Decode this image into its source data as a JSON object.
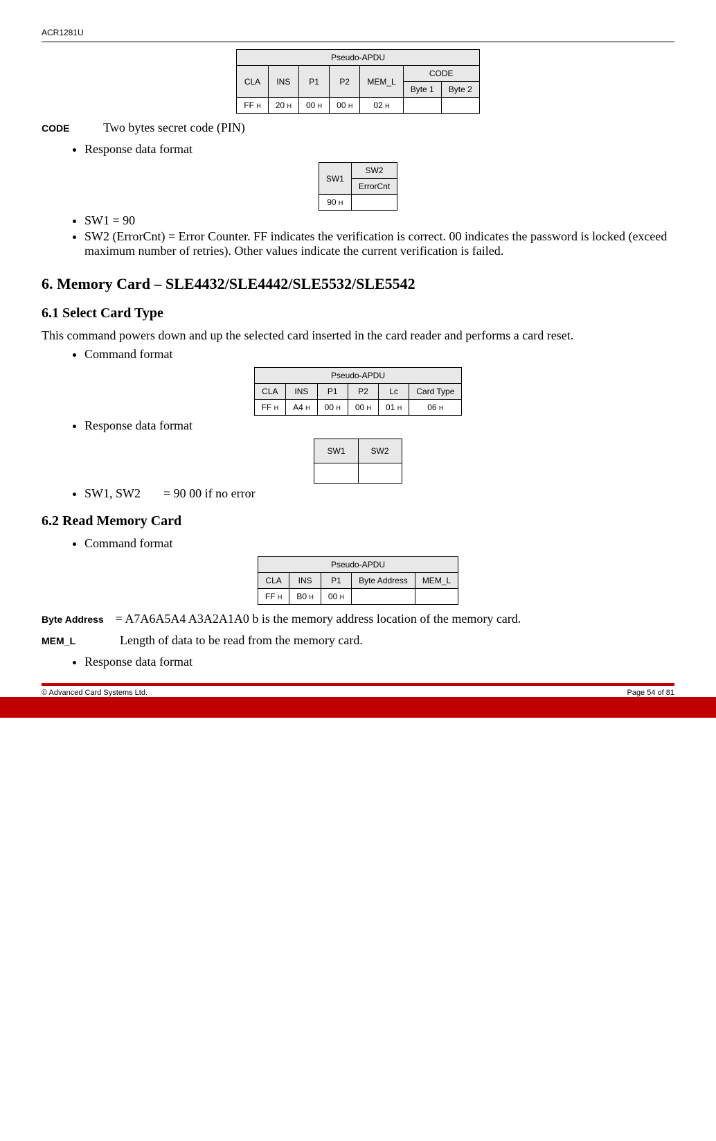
{
  "header": "ACR1281U",
  "table1": {
    "title": "Pseudo-APDU",
    "headers": [
      "CLA",
      "INS",
      "P1",
      "P2",
      "MEM_L",
      "CODE"
    ],
    "subheaders": [
      "Byte 1",
      "Byte 2"
    ],
    "row": [
      "FF",
      "20",
      "00",
      "00",
      "02",
      "",
      ""
    ]
  },
  "code_def": {
    "label": "CODE",
    "text": "Two bytes secret code (PIN)"
  },
  "bullets1": [
    "Response data format"
  ],
  "table2": {
    "h1": "SW1",
    "h2": "SW2",
    "h2sub": "ErrorCnt",
    "row": [
      "90",
      ""
    ]
  },
  "bullets2": [
    "SW1 = 90",
    "SW2 (ErrorCnt) = Error Counter.  FF indicates the verification is correct.  00 indicates the password is locked (exceed maximum number of retries).  Other values indicate the current verification is failed."
  ],
  "section6": "6. Memory Card – SLE4432/SLE4442/SLE5532/SLE5542",
  "section61": "6.1 Select Card Type",
  "para61": "This command powers down and up the selected card inserted in the card reader and performs a card reset.",
  "bullets3": [
    "Command format"
  ],
  "table3": {
    "title": "Pseudo-APDU",
    "headers": [
      "CLA",
      "INS",
      "P1",
      "P2",
      "Lc",
      "Card Type"
    ],
    "row": [
      "FF",
      "A4",
      "00",
      "00",
      "01",
      "06"
    ]
  },
  "bullets4": [
    "Response data format"
  ],
  "table4": {
    "h1": "SW1",
    "h2": "SW2"
  },
  "bullets5_prefix": "SW1, SW2",
  "bullets5_text": "= 90  00  if no error",
  "section62": "6.2 Read Memory Card",
  "bullets6": [
    "Command format"
  ],
  "table5": {
    "title": "Pseudo-APDU",
    "headers": [
      "CLA",
      "INS",
      "P1",
      "Byte Address",
      "MEM_L"
    ],
    "row": [
      "FF",
      "B0",
      "00",
      "",
      ""
    ]
  },
  "byte_addr": {
    "label": "Byte Address",
    "text": "= A7A6A5A4 A3A2A1A0 b is the memory address location of the memory card."
  },
  "mem_l": {
    "label": "MEM_L",
    "text": "Length of data to be read from the memory card."
  },
  "bullets7": [
    "Response data format"
  ],
  "footer": {
    "left": "© Advanced Card Systems Ltd.",
    "right": "Page 54 of 81"
  },
  "h_suffix": "H"
}
